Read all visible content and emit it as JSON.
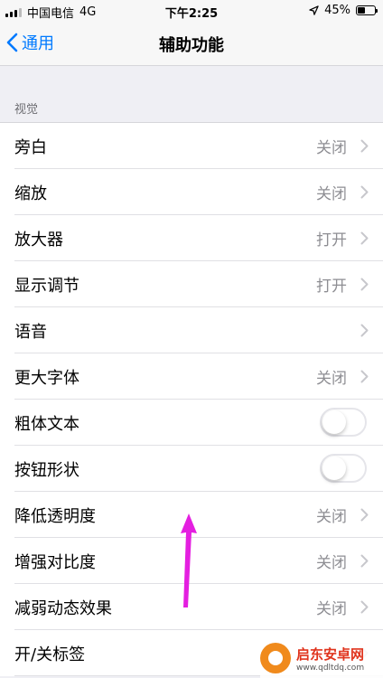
{
  "status_bar": {
    "carrier": "中国电信",
    "network": "4G",
    "time": "下午2:25",
    "battery_percent": "45%",
    "battery_level": 0.45
  },
  "nav": {
    "back_label": "通用",
    "title": "辅助功能"
  },
  "section": {
    "header": "视觉"
  },
  "rows": [
    {
      "label": "旁白",
      "value": "关闭",
      "kind": "disclosure"
    },
    {
      "label": "缩放",
      "value": "关闭",
      "kind": "disclosure"
    },
    {
      "label": "放大器",
      "value": "打开",
      "kind": "disclosure"
    },
    {
      "label": "显示调节",
      "value": "打开",
      "kind": "disclosure"
    },
    {
      "label": "语音",
      "value": "",
      "kind": "disclosure"
    },
    {
      "label": "更大字体",
      "value": "关闭",
      "kind": "disclosure"
    },
    {
      "label": "粗体文本",
      "value": "",
      "kind": "toggle",
      "on": false
    },
    {
      "label": "按钮形状",
      "value": "",
      "kind": "toggle",
      "on": false
    },
    {
      "label": "降低透明度",
      "value": "关闭",
      "kind": "disclosure"
    },
    {
      "label": "增强对比度",
      "value": "关闭",
      "kind": "disclosure"
    },
    {
      "label": "减弱动态效果",
      "value": "关闭",
      "kind": "disclosure"
    },
    {
      "label": "开/关标签",
      "value": "",
      "kind": "disclosure"
    }
  ],
  "watermark": {
    "title": "启东安卓网",
    "url": "www.qdltdq.com"
  },
  "colors": {
    "accent": "#007aff",
    "annotation_arrow": "#e41fe0",
    "watermark_orange": "#f08a1c"
  },
  "icons": {
    "back": "chevron-left-icon",
    "disclosure": "chevron-right-icon",
    "location": "location-arrow-icon"
  }
}
